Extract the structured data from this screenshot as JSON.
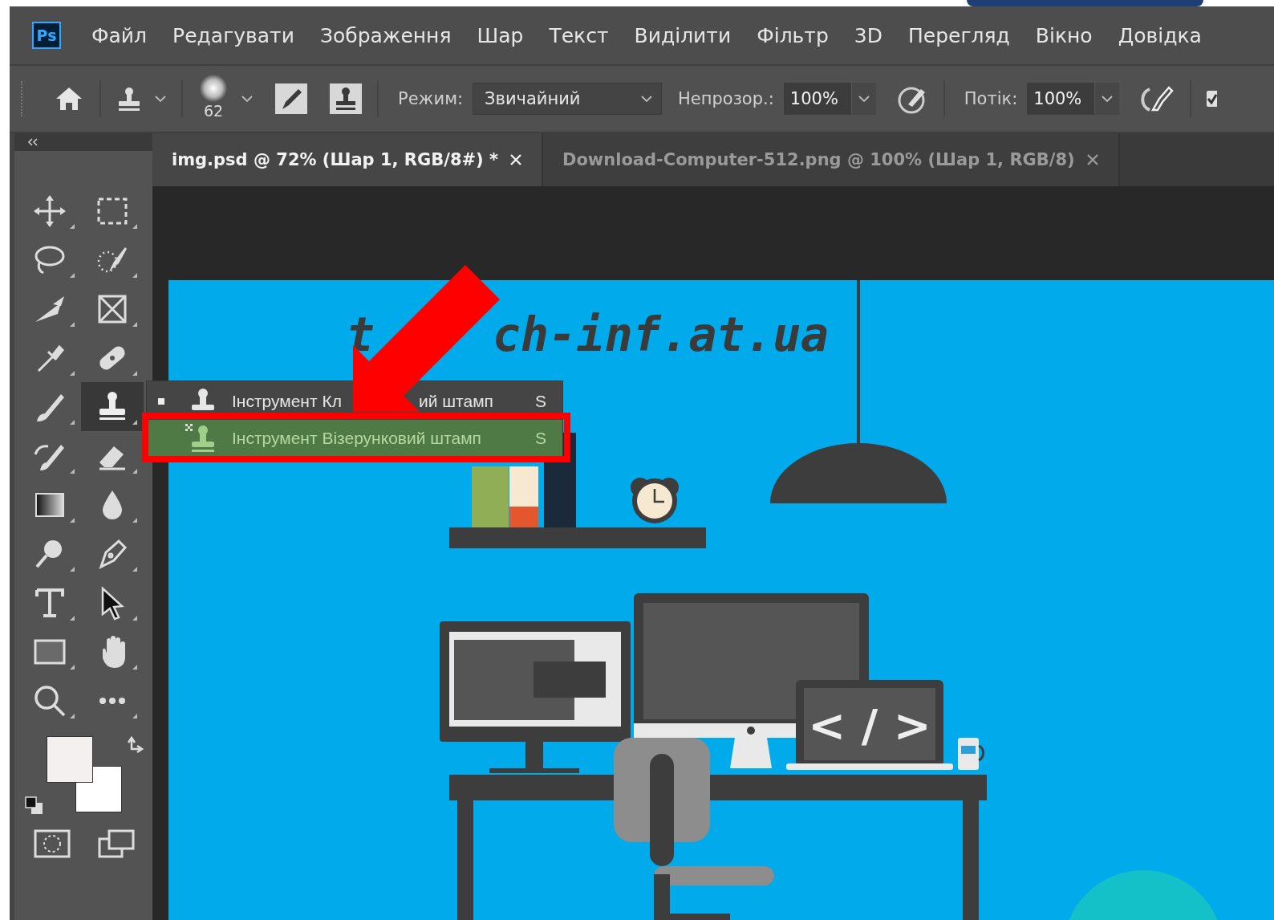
{
  "app_logo": "Ps",
  "menu": [
    "Файл",
    "Редагувати",
    "Зображення",
    "Шар",
    "Текст",
    "Виділити",
    "Фільтр",
    "3D",
    "Перегляд",
    "Вікно",
    "Довідка"
  ],
  "options_bar": {
    "brush_size": "62",
    "mode_label": "Режим:",
    "mode_value": "Звичайний",
    "opacity_label": "Непрозор.:",
    "opacity_value": "100%",
    "flow_label": "Потік:",
    "flow_value": "100%"
  },
  "tabs": [
    {
      "label": "img.psd @ 72% (Шар 1, RGB/8#) *",
      "selected": true
    },
    {
      "label": "Download-Computer-512.png @ 100% (Шар 1, RGB/8)",
      "selected": false
    }
  ],
  "tools": [
    {
      "kind": "move",
      "selected": false
    },
    {
      "kind": "marquee",
      "selected": false
    },
    {
      "kind": "lasso",
      "selected": false
    },
    {
      "kind": "brush-select",
      "selected": false
    },
    {
      "kind": "knife",
      "selected": false
    },
    {
      "kind": "frame",
      "selected": false
    },
    {
      "kind": "eyedropper",
      "selected": false
    },
    {
      "kind": "bandage",
      "selected": false
    },
    {
      "kind": "brush",
      "selected": false
    },
    {
      "kind": "stamp",
      "selected": true
    },
    {
      "kind": "history-brush",
      "selected": false
    },
    {
      "kind": "eraser",
      "selected": false
    },
    {
      "kind": "gradient",
      "selected": false
    },
    {
      "kind": "drop",
      "selected": false
    },
    {
      "kind": "lollipop",
      "selected": false
    },
    {
      "kind": "pen-nib",
      "selected": false
    },
    {
      "kind": "type",
      "selected": false
    },
    {
      "kind": "cursor",
      "selected": false
    },
    {
      "kind": "rectangle",
      "selected": false
    },
    {
      "kind": "hand",
      "selected": false
    },
    {
      "kind": "zoom",
      "selected": false
    },
    {
      "kind": "more",
      "selected": false
    }
  ],
  "flyout": [
    {
      "kind": "clone",
      "active": true,
      "selected": false,
      "texts": [
        "Інструмент Кл",
        "ий штамп"
      ],
      "shortcut": "S"
    },
    {
      "kind": "pattern",
      "active": false,
      "selected": true,
      "texts": [
        "Інструмент Візерунковий штамп"
      ],
      "shortcut": "S"
    }
  ],
  "canvas": {
    "site_parts": [
      "t",
      "ch-inf.at.ua"
    ],
    "code_sign": "< / >"
  }
}
